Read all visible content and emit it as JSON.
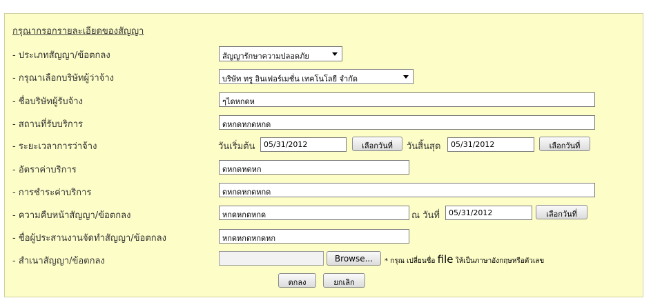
{
  "heading": "กรุณากรอกรายละเอียดของสัญญา",
  "rows": {
    "type_label": "- ประเภทสัญญา/ข้อตกลง",
    "company_label": "- กรุณาเลือกบริษัทผู้ว่าจ้าง",
    "contractor_label": "- ชื่อบริษัทผู้รับจ้าง",
    "location_label": "- สถานที่รับบริการ",
    "period_label": "- ระยะเวลาการว่าจ้าง",
    "rate_label": "- อัตราค่าบริการ",
    "payment_label": "- การชำระค่าบริการ",
    "progress_label": "- ความคืบหน้าสัญญา/ข้อตกลง",
    "coordinator_label": "- ชื่อผู้ประสานงานจัดทำสัญญา/ข้อตกลง",
    "copy_label": "- สำเนาสัญญา/ข้อตกลง"
  },
  "fields": {
    "contract_type": "สัญญารักษาความปลอดภัย",
    "company": "บริษัท ทรู อินเฟอร์เมชั่น เทคโนโลยี จำกัด",
    "contractor": "ๆไดหกดห",
    "location": "ดหกดหกดหกด",
    "start_label": "วันเริ่มต้น",
    "start_date": "05/31/2012",
    "end_label": "วันสิ้นสุด",
    "end_date": "05/31/2012",
    "rate": "ดหกดหดหก",
    "payment": "ดหกดหกดหกด",
    "progress": "หกดหกดหกด",
    "as_of_label": "ณ วันที่",
    "as_of_date": "05/31/2012",
    "coordinator": "หกดหกดหกดหก",
    "file_note_prefix": "* กรุณ เปลี่ยนชื่อ",
    "file_note_file": "file",
    "file_note_suffix": "ให้เป็นภาษาอังกฤษหรือตัวเลข"
  },
  "buttons": {
    "pick_date": "เลือกวันที่",
    "browse": "Browse...",
    "submit": "ตกลง",
    "cancel": "ยกเลิก"
  }
}
